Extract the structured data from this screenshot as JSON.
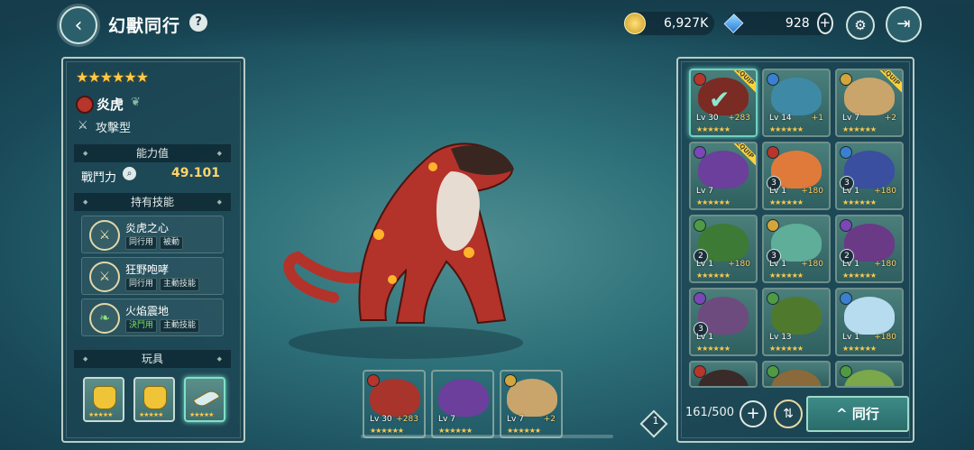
{
  "header": {
    "title": "幻獸同行",
    "help_label": "?",
    "gold": "6,927K",
    "gems": "928",
    "plus_label": "+"
  },
  "monster": {
    "stars": "★★★★★★",
    "name": "炎虎",
    "type": "攻擊型",
    "element_color": "#b7352a"
  },
  "ability": {
    "section_title": "能力值",
    "power_label": "戰鬥力",
    "power_value": "49.101"
  },
  "skills": {
    "section_title": "持有技能",
    "items": [
      {
        "name": "炎虎之心",
        "tags": [
          "同行用",
          "被動"
        ],
        "icon": "crossed-swords-icon"
      },
      {
        "name": "狂野咆哮",
        "tags": [
          "同行用",
          "主動技能"
        ],
        "icon": "crossed-swords-icon"
      },
      {
        "name": "火焰震地",
        "tags": [
          "決鬥用",
          "主動技能"
        ],
        "icon": "leaf-wing-icon"
      }
    ]
  },
  "toys": {
    "section_title": "玩具",
    "items": [
      {
        "icon": "glove-icon",
        "stars": "★★★★★"
      },
      {
        "icon": "glove-icon",
        "stars": "★★★★★"
      },
      {
        "icon": "feather-icon",
        "stars": "★★★★★"
      }
    ]
  },
  "team": [
    {
      "lv": "Lv 30",
      "plus": "+283",
      "stars": "★★★★★★",
      "color": "#a8342c"
    },
    {
      "lv": "Lv 7",
      "plus": "",
      "stars": "★★★★★★",
      "color": "#6b3f9b"
    },
    {
      "lv": "Lv 7",
      "plus": "+2",
      "stars": "★★★★★★",
      "color": "#c9a56b"
    }
  ],
  "page_number": "1",
  "roster": {
    "count": "161/500",
    "plus_label": "+",
    "follow_label": "同行",
    "follow_arrow": "^",
    "equip_label": "EQUIP",
    "cards": [
      {
        "lv": "Lv 30",
        "plus": "+283",
        "badge": "",
        "el": "#b7352a",
        "art": "#7a2b24",
        "equip": true,
        "sel": true
      },
      {
        "lv": "Lv 14",
        "plus": "+1",
        "badge": "",
        "el": "#3b7fd0",
        "art": "#3e8aa6",
        "equip": false,
        "sel": false
      },
      {
        "lv": "Lv 7",
        "plus": "+2",
        "badge": "",
        "el": "#d4a53b",
        "art": "#c9a56b",
        "equip": true,
        "sel": false
      },
      {
        "lv": "Lv 7",
        "plus": "",
        "badge": "",
        "el": "#7b47b6",
        "art": "#6b3f9b",
        "equip": true,
        "sel": false
      },
      {
        "lv": "Lv 1",
        "plus": "+180",
        "badge": "3",
        "el": "#b7352a",
        "art": "#e07a3a",
        "equip": false,
        "sel": false
      },
      {
        "lv": "Lv 1",
        "plus": "+180",
        "badge": "3",
        "el": "#3b7fd0",
        "art": "#3a4fa0",
        "equip": false,
        "sel": false
      },
      {
        "lv": "Lv 1",
        "plus": "+180",
        "badge": "2",
        "el": "#4f9a43",
        "art": "#3d7a35",
        "equip": false,
        "sel": false
      },
      {
        "lv": "Lv 1",
        "plus": "+180",
        "badge": "3",
        "el": "#d4a53b",
        "art": "#5fae9a",
        "equip": false,
        "sel": false
      },
      {
        "lv": "Lv 1",
        "plus": "+180",
        "badge": "2",
        "el": "#7b47b6",
        "art": "#6a3a86",
        "equip": false,
        "sel": false
      },
      {
        "lv": "Lv 1",
        "plus": "",
        "badge": "3",
        "el": "#7b47b6",
        "art": "#6e4b7e",
        "equip": false,
        "sel": false
      },
      {
        "lv": "Lv 13",
        "plus": "",
        "badge": "",
        "el": "#4f9a43",
        "art": "#4f7a2e",
        "equip": false,
        "sel": false
      },
      {
        "lv": "Lv 1",
        "plus": "+180",
        "badge": "",
        "el": "#3b7fd0",
        "art": "#b7dcef",
        "equip": false,
        "sel": false
      },
      {
        "lv": "",
        "plus": "",
        "badge": "",
        "el": "#b7352a",
        "art": "#3a2a2a",
        "equip": false,
        "sel": false
      },
      {
        "lv": "",
        "plus": "",
        "badge": "",
        "el": "#4f9a43",
        "art": "#8a6a3a",
        "equip": false,
        "sel": false
      },
      {
        "lv": "",
        "plus": "",
        "badge": "",
        "el": "#4f9a43",
        "art": "#7aa84a",
        "equip": false,
        "sel": false
      }
    ]
  }
}
